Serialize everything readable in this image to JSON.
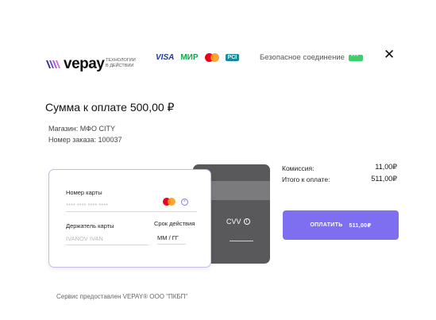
{
  "header": {
    "logo_word": "vepay",
    "logo_tagline": "ТЕХНОЛОГИИ В ДЕЙСТВИИ",
    "payment_systems": {
      "visa": "VISA",
      "mir": "МИР",
      "pci": "PCI"
    },
    "secure_text": "Безопасное соединение",
    "close": "✕"
  },
  "order": {
    "title": "Сумма к оплате 500,00 ₽",
    "merchant": "Магазин: МФО CITY",
    "order_number": "Номер заказа: 100037"
  },
  "card": {
    "number_label": "Номер карты",
    "number_placeholder": "**** **** **** ****",
    "holder_label": "Держатель карты",
    "holder_placeholder": "IVANOV IVAN",
    "expiry_label": "Срок действия",
    "expiry_placeholder": "ММ / ГГ",
    "cvv_label": "CVV",
    "info_glyph": "i",
    "clear_glyph": "×"
  },
  "totals": {
    "commission_label": "Комиссия:",
    "commission_value": "11,00₽",
    "total_label": "Итого к оплате:",
    "total_value": "511,00₽"
  },
  "pay_button": {
    "label": "ОПЛАТИТЬ",
    "amount": "511,00₽"
  },
  "footer": "Сервис предоставлен VEPAY® ООО \"ПКБП\"",
  "colors": {
    "accent": "#7d6ff0",
    "card_back": "#59595c",
    "secure": "#3fcf6a"
  }
}
